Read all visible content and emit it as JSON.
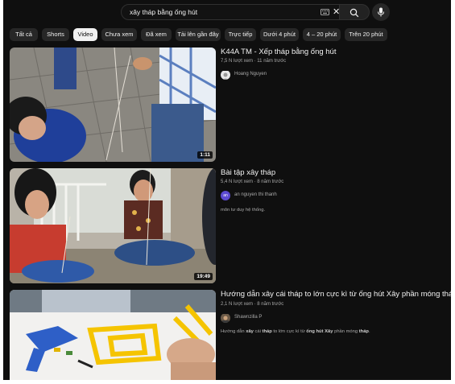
{
  "search": {
    "query": "xây tháp bằng ống hút"
  },
  "chips": [
    {
      "label": "Tất cả",
      "active": false
    },
    {
      "label": "Shorts",
      "active": false
    },
    {
      "label": "Video",
      "active": true
    },
    {
      "label": "Chưa xem",
      "active": false
    },
    {
      "label": "Đã xem",
      "active": false
    },
    {
      "label": "Tải lên gần đây",
      "active": false
    },
    {
      "label": "Trực tiếp",
      "active": false
    },
    {
      "label": "Dưới 4 phút",
      "active": false
    },
    {
      "label": "4 – 20 phút",
      "active": false
    },
    {
      "label": "Trên 20 phút",
      "active": false
    }
  ],
  "results": [
    {
      "title": "K44A TM - Xếp tháp bằng ống hút",
      "meta": "7,5 N lượt xem · 11 năm trước",
      "channel": "Hoang Nguyen",
      "duration": "1:11",
      "description": ""
    },
    {
      "title": "Bài tập xây tháp",
      "meta": "5,4 N lượt xem · 8 năm trước",
      "channel": "an nguyen thi thanh",
      "avatar_text": "an",
      "duration": "19:49",
      "description": "môn tư duy hệ thống."
    },
    {
      "title": "Hướng dẫn xây cái tháp to lớn cực kì từ ống hút Xây phần móng tháp",
      "meta": "2,1 N lượt xem · 8 năm trước",
      "channel": "Shawnzilla P",
      "duration": "",
      "description_parts": [
        "Hướng dẫn ",
        "xây",
        " cái ",
        "tháp",
        " to lớn cực kì từ ",
        "ống hút",
        " ",
        "Xây",
        " phần móng ",
        "tháp",
        "."
      ]
    }
  ],
  "colors": {
    "background": "#0f0f0f",
    "chip": "#272727",
    "chip_active": "#f1f1f1",
    "avatar_purple": "#5c4ad0"
  }
}
